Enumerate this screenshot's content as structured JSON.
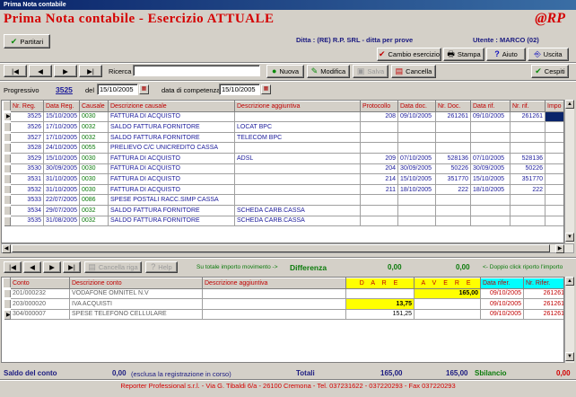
{
  "window": {
    "title": "Prima Nota contabile"
  },
  "app": {
    "title": "Prima Nota contabile - Esercizio ATTUALE",
    "logo": "@RP"
  },
  "toolbar1": {
    "partitari": "Partitari",
    "ditta": "Ditta : (RE) R.P. SRL - ditta per prove",
    "utente": "Utente : MARCO (02)",
    "cambio": "Cambio esercizio",
    "stampa": "Stampa",
    "aiuto": "Aiuto",
    "uscita": "Uscita"
  },
  "toolbar2": {
    "first": "|◀",
    "prev": "◀",
    "next": "▶",
    "last": "▶|",
    "ricerca_label": "Ricerca",
    "ricerca_value": "",
    "nuova": "Nuova",
    "modifica": "Modifica",
    "salva": "Salva",
    "cancella": "Cancella",
    "cespiti": "Cespiti"
  },
  "header": {
    "progressivo_label": "Progressivo",
    "progressivo_value": "3525",
    "del_label": "del",
    "del_value": "15/10/2005",
    "competenza_label": "data di competenza",
    "competenza_value": "15/10/2005"
  },
  "grid1": {
    "columns": [
      "Nr. Reg.",
      "Data Reg.",
      "Causale",
      "Descrizione causale",
      "Descrizione aggiuntiva",
      "Protocollo",
      "Data doc.",
      "Nr. Doc.",
      "Data rif.",
      "Nr. rif.",
      "Impo"
    ],
    "rows": [
      [
        "3525",
        "15/10/2005",
        "0030",
        "FATTURA DI ACQUISTO",
        "",
        "208",
        "09/10/2005",
        "261261",
        "09/10/2005",
        "261261",
        ""
      ],
      [
        "3526",
        "17/10/2005",
        "0032",
        "SALDO FATTURA FORNITORE",
        "LOCAT BPC",
        "",
        "",
        "",
        "",
        "",
        ""
      ],
      [
        "3527",
        "17/10/2005",
        "0032",
        "SALDO FATTURA FORNITORE",
        "TELECOM BPC",
        "",
        "",
        "",
        "",
        "",
        ""
      ],
      [
        "3528",
        "24/10/2005",
        "0055",
        "PRELIEVO C/C UNICREDITO CASSA",
        "",
        "",
        "",
        "",
        "",
        "",
        ""
      ],
      [
        "3529",
        "15/10/2005",
        "0030",
        "FATTURA DI ACQUISTO",
        "ADSL",
        "209",
        "07/10/2005",
        "528136",
        "07/10/2005",
        "528136",
        ""
      ],
      [
        "3530",
        "30/09/2005",
        "0030",
        "FATTURA DI ACQUISTO",
        "",
        "204",
        "30/09/2005",
        "50226",
        "30/09/2005",
        "50226",
        ""
      ],
      [
        "3531",
        "31/10/2005",
        "0030",
        "FATTURA DI ACQUISTO",
        "",
        "214",
        "15/10/2005",
        "351770",
        "15/10/2005",
        "351770",
        ""
      ],
      [
        "3532",
        "31/10/2005",
        "0030",
        "FATTURA DI ACQUISTO",
        "",
        "211",
        "18/10/2005",
        "222",
        "18/10/2005",
        "222",
        ""
      ],
      [
        "3533",
        "22/07/2005",
        "0086",
        "SPESE POSTALI RACC.SIMP CASSA",
        "",
        "",
        "",
        "",
        "",
        "",
        ""
      ],
      [
        "3534",
        "29/07/2005",
        "0032",
        "SALDO FATTURA FORNITORE",
        "SCHEDA CARB.CASSA",
        "",
        "",
        "",
        "",
        "",
        ""
      ],
      [
        "3535",
        "31/08/2005",
        "0032",
        "SALDO FATTURA FORNITORE",
        "SCHEDA CARB.CASSA",
        "",
        "",
        "",
        "",
        "",
        ""
      ]
    ]
  },
  "toolbar3": {
    "cancella_riga": "Cancella riga",
    "help": "Help",
    "su_totale": "Su totale importo movimento ->",
    "differenza_label": "Differenza",
    "diff1": "0,00",
    "diff2": "0,00",
    "doppio": "<- Doppio click riporto l'importo"
  },
  "grid2": {
    "columns": [
      "Conto",
      "Descrizione conto",
      "Descrizione aggiuntiva",
      "D A R E",
      "A V E R E",
      "Data rifer.",
      "Nr. Rifer."
    ],
    "rows": [
      [
        "201/000232",
        "VODAFONE OMNITEL N.V",
        "",
        "",
        "165,00",
        "09/10/2005",
        "261261"
      ],
      [
        "203/000020",
        "IVA ACQUISTI",
        "",
        "13,75",
        "",
        "09/10/2005",
        "261261"
      ],
      [
        "304/000007",
        "SPESE TELEFONO CELLULARE",
        "",
        "151,25",
        "",
        "09/10/2005",
        "261261"
      ]
    ]
  },
  "totals": {
    "saldo_label": "Saldo del conto",
    "saldo_value": "0,00",
    "esclusa": "(esclusa la registrazione in corso)",
    "totali_label": "Totali",
    "tot_dare": "165,00",
    "tot_avere": "165,00",
    "sbilancio_label": "Sbilancio",
    "sbilancio_value": "0,00"
  },
  "footer": "Reporter Professional s.r.l.  -  Via G. Tibaldi 6/a  -  26100 Cremona  -  Tel. 037231622 - 037220293  -  Fax 037220293"
}
